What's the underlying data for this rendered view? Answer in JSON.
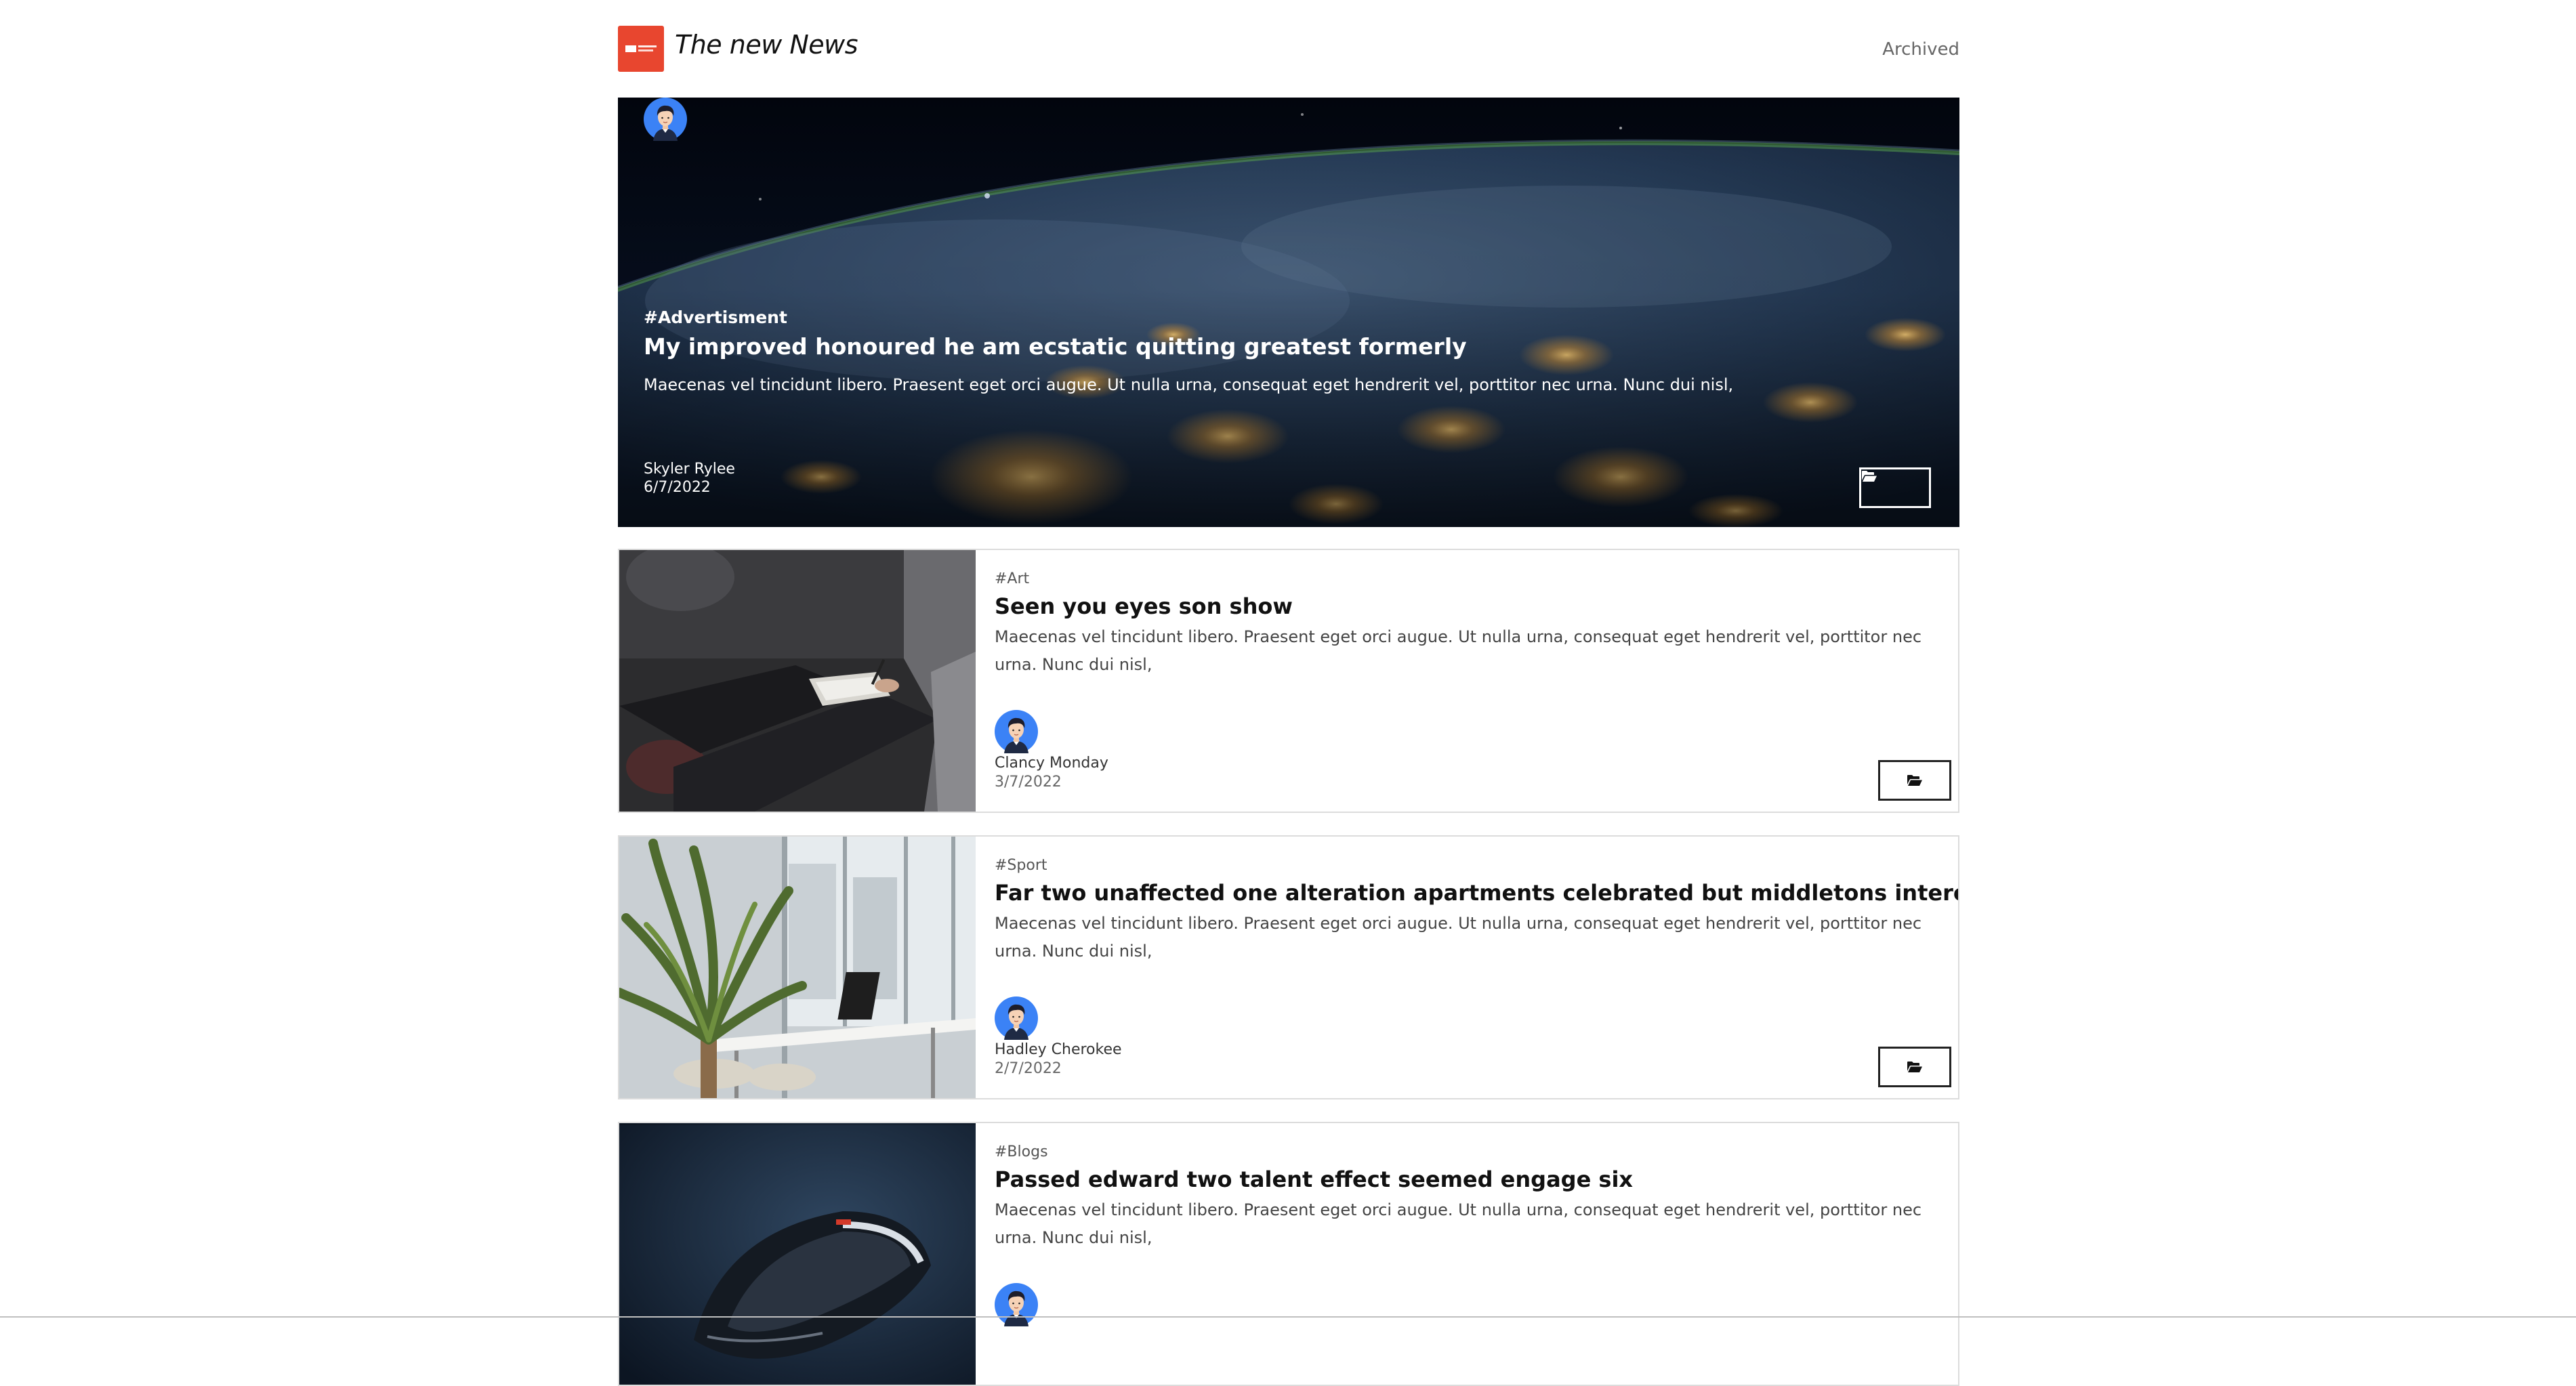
{
  "header": {
    "site_title": "The new News",
    "archived_label": "Archived"
  },
  "hero": {
    "tag": "#Advertisment",
    "title": "My improved honoured he am ecstatic quitting greatest formerly",
    "text": "Maecenas vel tincidunt libero. Praesent eget orci augue. Ut nulla urna, consequat eget hendrerit vel, porttitor nec urna. Nunc dui nisl,",
    "author": "Skyler Rylee",
    "date": "6/7/2022",
    "archive_icon": "folder-open-icon"
  },
  "articles": [
    {
      "tag": "#Art",
      "title": "Seen you eyes son show",
      "text": "Maecenas vel tincidunt libero. Praesent eget orci augue. Ut nulla urna, consequat eget hendrerit vel, porttitor nec urna. Nunc dui nisl,",
      "author": "Clancy Monday",
      "date": "3/7/2022"
    },
    {
      "tag": "#Sport",
      "title": "Far two unaffected one alteration apartments celebrated but middletons interested",
      "text": "Maecenas vel tincidunt libero. Praesent eget orci augue. Ut nulla urna, consequat eget hendrerit vel, porttitor nec urna. Nunc dui nisl,",
      "author": "Hadley Cherokee",
      "date": "2/7/2022"
    },
    {
      "tag": "#Blogs",
      "title": "Passed edward two talent effect seemed engage six",
      "text": "Maecenas vel tincidunt libero. Praesent eget orci augue. Ut nulla urna, consequat eget hendrerit vel, porttitor nec urna. Nunc dui nisl,"
    }
  ],
  "colors": {
    "brand": "#e8462f",
    "avatar": "#3b82f6"
  }
}
